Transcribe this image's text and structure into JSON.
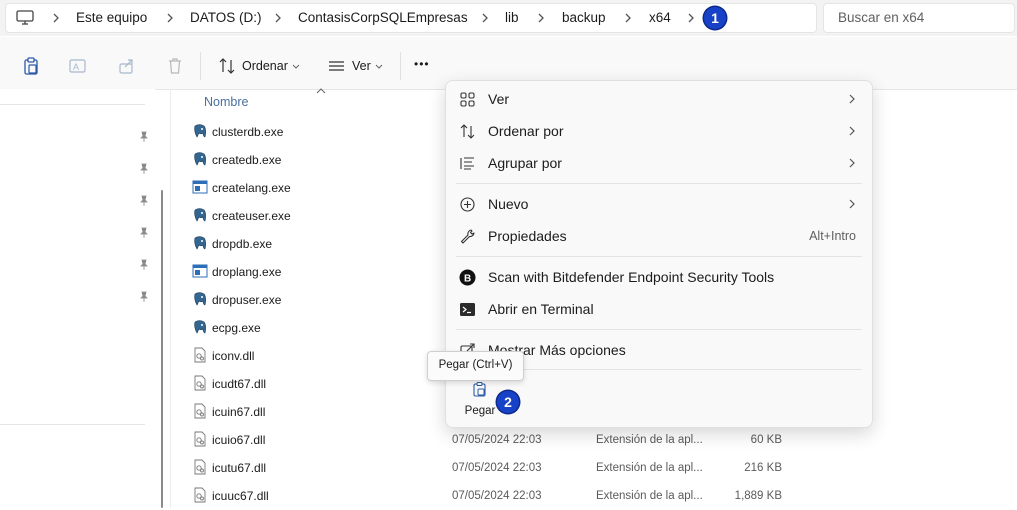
{
  "address": {
    "crumbs": [
      "Este equipo",
      "DATOS (D:)",
      "ContasisCorpSQLEmpresas",
      "lib",
      "backup",
      "x64"
    ],
    "search_placeholder": "Buscar en x64"
  },
  "toolbar": {
    "sort_label": "Ordenar",
    "view_label": "Ver",
    "more_label": "•••"
  },
  "filelist": {
    "column_name": "Nombre",
    "files": [
      {
        "name": "clusterdb.exe",
        "icon": "postgres-elephant-icon"
      },
      {
        "name": "createdb.exe",
        "icon": "postgres-elephant-icon"
      },
      {
        "name": "createlang.exe",
        "icon": "app-window-icon"
      },
      {
        "name": "createuser.exe",
        "icon": "postgres-elephant-icon"
      },
      {
        "name": "dropdb.exe",
        "icon": "postgres-elephant-icon"
      },
      {
        "name": "droplang.exe",
        "icon": "app-window-icon"
      },
      {
        "name": "dropuser.exe",
        "icon": "postgres-elephant-icon"
      },
      {
        "name": "ecpg.exe",
        "icon": "postgres-elephant-icon"
      },
      {
        "name": "iconv.dll",
        "icon": "dll-file-icon"
      },
      {
        "name": "icudt67.dll",
        "icon": "dll-file-icon"
      },
      {
        "name": "icuin67.dll",
        "icon": "dll-file-icon"
      },
      {
        "name": "icuio67.dll",
        "icon": "dll-file-icon",
        "date": "07/05/2024 22:03",
        "type": "Extensión de la apl...",
        "size": "60 KB"
      },
      {
        "name": "icutu67.dll",
        "icon": "dll-file-icon",
        "date": "07/05/2024 22:03",
        "type": "Extensión de la apl...",
        "size": "216 KB"
      },
      {
        "name": "icuuc67.dll",
        "icon": "dll-file-icon",
        "date": "07/05/2024 22:03",
        "type": "Extensión de la apl...",
        "size": "1,889 KB"
      }
    ]
  },
  "context_menu": {
    "items": [
      {
        "label": "Ver",
        "icon": "view-grid-icon",
        "submenu": true
      },
      {
        "label": "Ordenar por",
        "icon": "sort-icon",
        "submenu": true
      },
      {
        "label": "Agrupar por",
        "icon": "group-list-icon",
        "submenu": true
      },
      {
        "label": "Nuevo",
        "icon": "new-plus-icon",
        "submenu": true
      },
      {
        "label": "Propiedades",
        "icon": "wrench-icon",
        "shortcut": "Alt+Intro"
      },
      {
        "label": "Scan with Bitdefender Endpoint Security Tools",
        "icon": "bitdefender-icon"
      },
      {
        "label": "Abrir en Terminal",
        "icon": "terminal-icon"
      },
      {
        "label": "Mostrar Más opciones",
        "icon": "more-options-icon"
      }
    ],
    "paste_label": "Pegar"
  },
  "tooltip": {
    "text": "Pegar (Ctrl+V)"
  },
  "annotations": {
    "badge_1": "1",
    "badge_2": "2"
  },
  "colors": {
    "accent": "#1741c7",
    "link_blue": "#4a6f9e"
  }
}
